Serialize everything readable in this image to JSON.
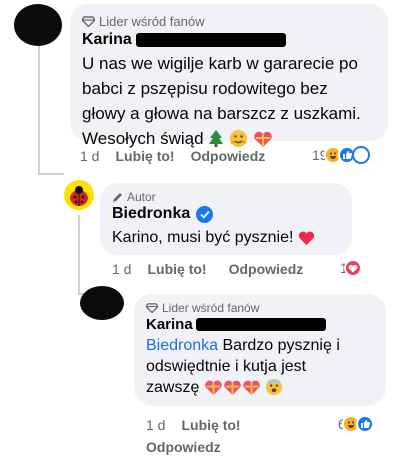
{
  "comments": [
    {
      "badge": "Lider wśród fanów",
      "author": "Karina",
      "text_lines": [
        "U nas we wigilje karb w gararecie po",
        "babci z pszępisu rodowitego bez",
        "głowy a głowa na barszcz z uszkami."
      ],
      "last_line": "Wesołych świąd",
      "time": "1 d",
      "like_label": "Lubię to!",
      "reply_label": "Odpowiedz",
      "reaction_count": "19"
    },
    {
      "badge": "Autor",
      "author": "Biedronka",
      "text": "Karino, musi być pysznie!",
      "time": "1 d",
      "like_label": "Lubię to!",
      "reply_label": "Odpowiedz",
      "reaction_count": "1"
    },
    {
      "badge": "Lider wśród fanów",
      "author": "Karina",
      "mention": "Biedronka",
      "text_first": " Bardzo pysznię i",
      "text_lines": [
        "odswiędtnie i kutja jest"
      ],
      "last_line": "zawszę",
      "time": "1 d",
      "like_label": "Lubię to!",
      "reply_label": "Odpowiedz",
      "reaction_count": "6"
    }
  ],
  "colors": {
    "bubble": "#f0f2f5",
    "meta": "#65676b",
    "link": "#216fdb",
    "verified": "#1877f2",
    "heart": "#f02849"
  }
}
